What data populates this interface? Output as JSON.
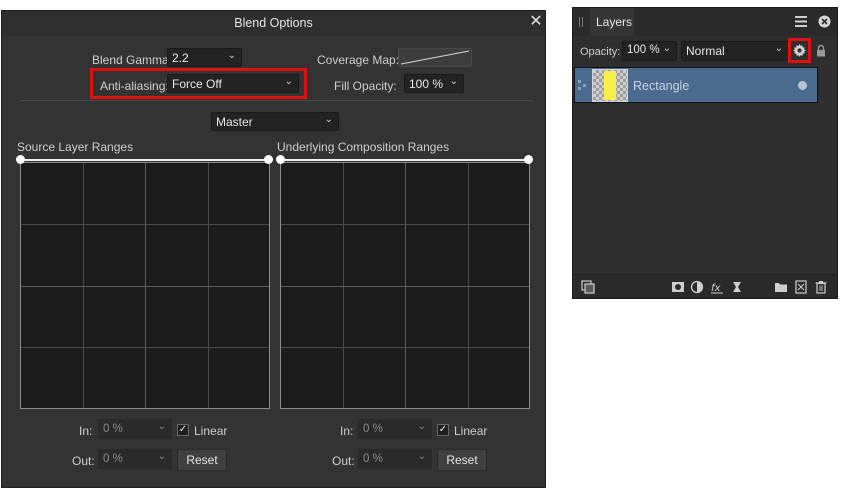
{
  "blend_options": {
    "title": "Blend Options",
    "close_glyph": "✕",
    "blend_gamma": {
      "label": "Blend Gamma:",
      "value": "2.2"
    },
    "anti_aliasing": {
      "label": "Anti-aliasing:",
      "value": "Force Off"
    },
    "coverage_map": {
      "label": "Coverage Map:"
    },
    "fill_opacity": {
      "label": "Fill Opacity:",
      "value": "100 %"
    },
    "channel": {
      "value": "Master"
    },
    "source": {
      "heading": "Source Layer Ranges",
      "in_label": "In:",
      "in_value": "0 %",
      "out_label": "Out:",
      "out_value": "0 %",
      "linear_label": "Linear",
      "linear_checked": true,
      "reset_label": "Reset"
    },
    "underlying": {
      "heading": "Underlying Composition Ranges",
      "in_label": "In:",
      "in_value": "0 %",
      "out_label": "Out:",
      "out_value": "0 %",
      "linear_label": "Linear",
      "linear_checked": true,
      "reset_label": "Reset"
    },
    "chevron_glyph": "⌄",
    "check_glyph": "✓"
  },
  "layers_panel": {
    "tab_label": "Layers",
    "opacity": {
      "label": "Opacity:",
      "value": "100 %"
    },
    "blend_mode": {
      "value": "Normal"
    },
    "layers": [
      {
        "name": "Rectangle",
        "visible": true
      }
    ]
  },
  "colors": {
    "highlight_red": "#e01010",
    "selected_layer": "#4a6a8f",
    "thumbnail_yellow": "#f6f04a"
  }
}
